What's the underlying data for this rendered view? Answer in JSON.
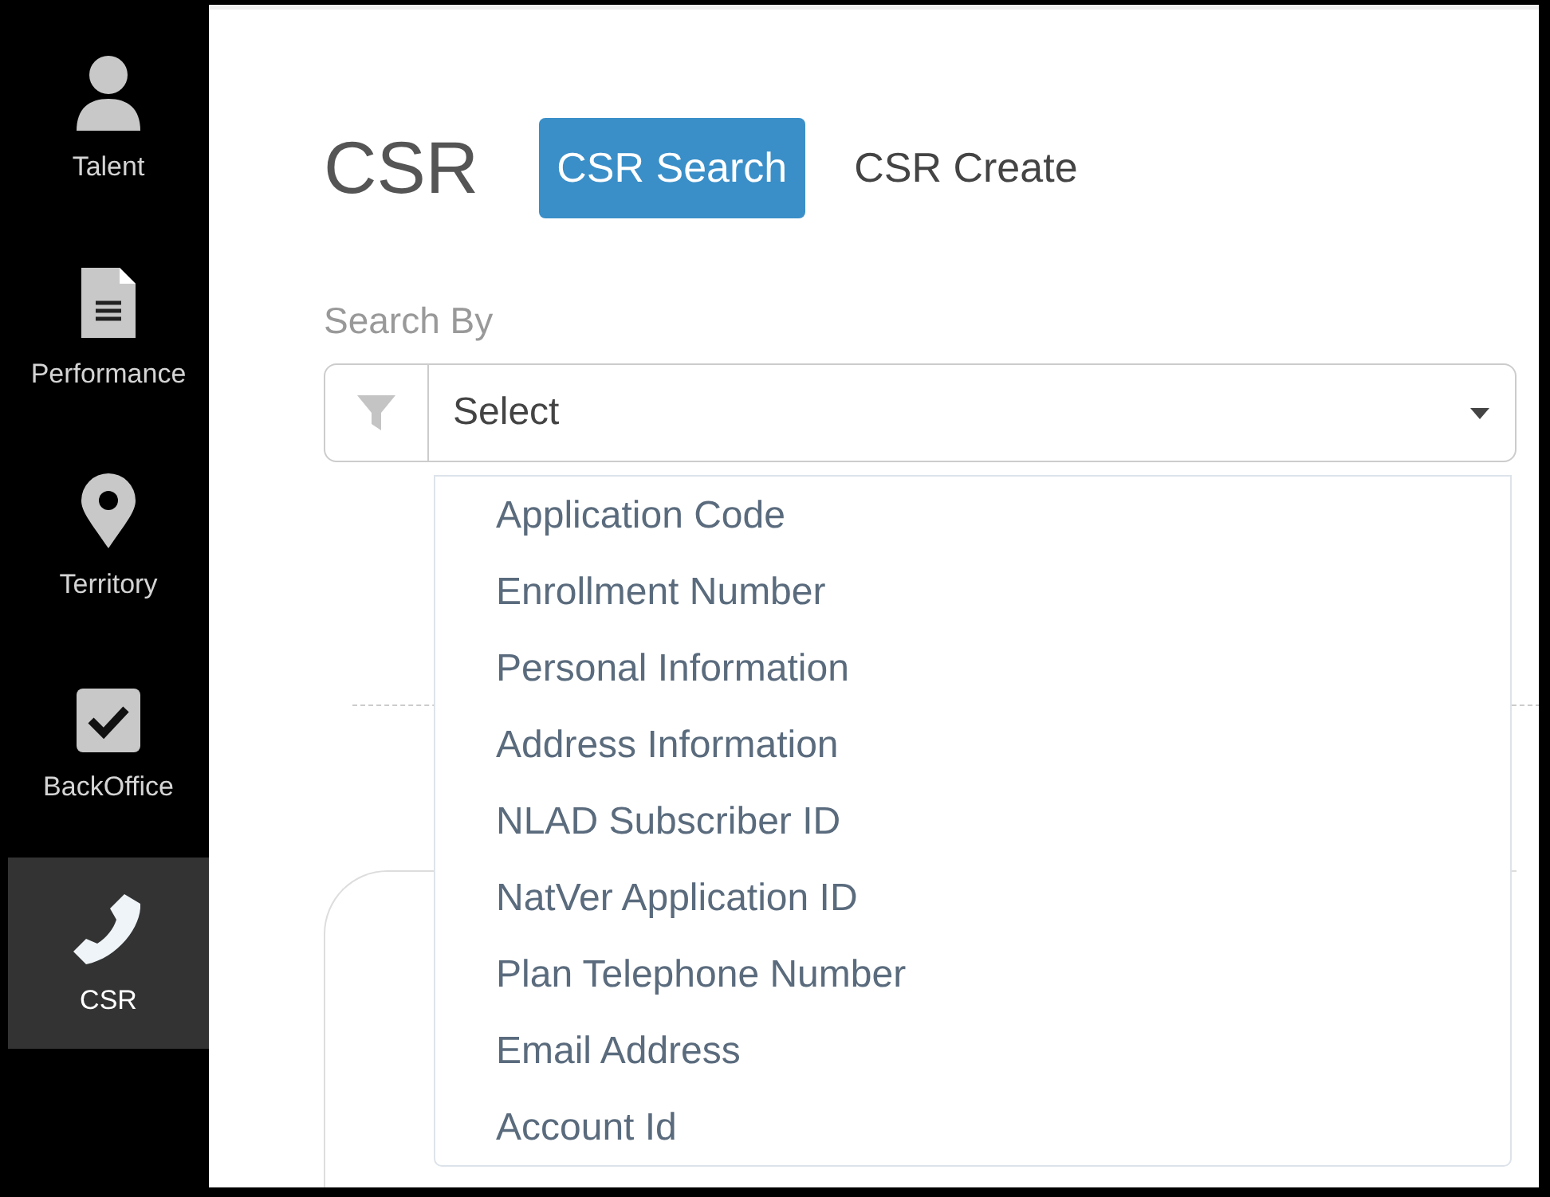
{
  "sidebar": {
    "items": [
      {
        "label": "Talent",
        "selected": false
      },
      {
        "label": "Performance",
        "selected": false
      },
      {
        "label": "Territory",
        "selected": false
      },
      {
        "label": "BackOffice",
        "selected": false
      },
      {
        "label": "CSR",
        "selected": true
      }
    ]
  },
  "header": {
    "title": "CSR"
  },
  "tabs": [
    {
      "label": "CSR Search",
      "selected": true
    },
    {
      "label": "CSR Create",
      "selected": false
    }
  ],
  "search_by": {
    "label": "Search By",
    "placeholder": "Select",
    "expanded": true,
    "options": [
      "Application Code",
      "Enrollment Number",
      "Personal Information",
      "Address Information",
      "NLAD Subscriber ID",
      "NatVer Application ID",
      "Plan Telephone Number",
      "Email Address",
      "Account Id"
    ]
  }
}
